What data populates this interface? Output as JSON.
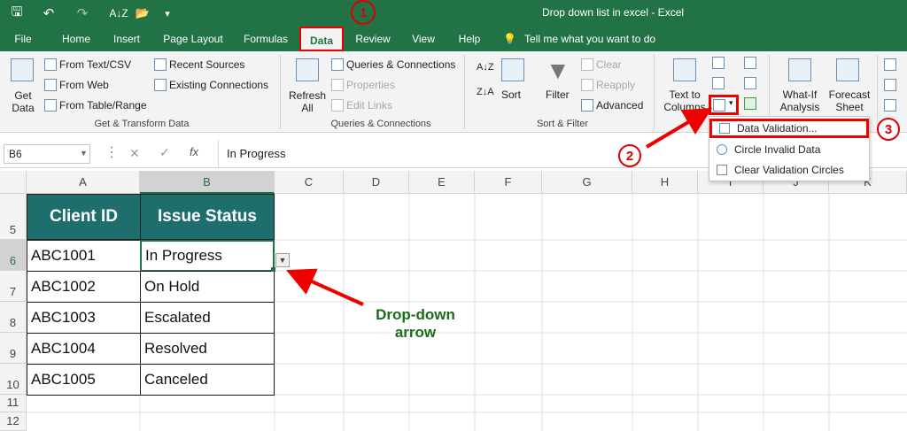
{
  "window": {
    "title": "Drop down list in excel  -  Excel"
  },
  "qat": {
    "save": "🖫",
    "undo": "↶",
    "redo": "↷",
    "sort": "A↓Z",
    "open": "📂",
    "more": "▾"
  },
  "tabs": [
    "File",
    "Home",
    "Insert",
    "Page Layout",
    "Formulas",
    "Data",
    "Review",
    "View",
    "Help"
  ],
  "tell_me": "Tell me what you want to do",
  "ribbon": {
    "get_data": "Get Data",
    "from_text": "From Text/CSV",
    "from_web": "From Web",
    "from_table": "From Table/Range",
    "recent_sources": "Recent Sources",
    "existing_connections": "Existing Connections",
    "group_get_transform": "Get & Transform Data",
    "refresh_all": "Refresh All",
    "queries_connections": "Queries & Connections",
    "properties": "Properties",
    "edit_links": "Edit Links",
    "group_queries": "Queries & Connections",
    "sort": "Sort",
    "filter": "Filter",
    "clear": "Clear",
    "reapply": "Reapply",
    "advanced": "Advanced",
    "group_sort_filter": "Sort & Filter",
    "text_to_columns": "Text to Columns",
    "what_if": "What-If Analysis",
    "forecast_sheet": "Forecast Sheet"
  },
  "dropdown_menu": {
    "items": [
      "Data Validation...",
      "Circle Invalid Data",
      "Clear Validation Circles"
    ]
  },
  "formula_bar": {
    "cell_ref": "B6",
    "value": "In Progress"
  },
  "columns": [
    "A",
    "B",
    "C",
    "D",
    "E",
    "F",
    "G",
    "H",
    "I",
    "J",
    "K"
  ],
  "rows": [
    "5",
    "6",
    "7",
    "8",
    "9",
    "10",
    "11",
    "12"
  ],
  "table": {
    "headers": [
      "Client ID",
      "Issue Status"
    ],
    "rows": [
      [
        "ABC1001",
        "In Progress"
      ],
      [
        "ABC1002",
        "On Hold"
      ],
      [
        "ABC1003",
        "Escalated"
      ],
      [
        "ABC1004",
        "Resolved"
      ],
      [
        "ABC1005",
        "Canceled"
      ]
    ]
  },
  "annotations": {
    "step1": "1",
    "step2": "2",
    "step3": "3",
    "dropdown_label": "Drop-down arrow",
    "color": "#1a6b1a"
  }
}
